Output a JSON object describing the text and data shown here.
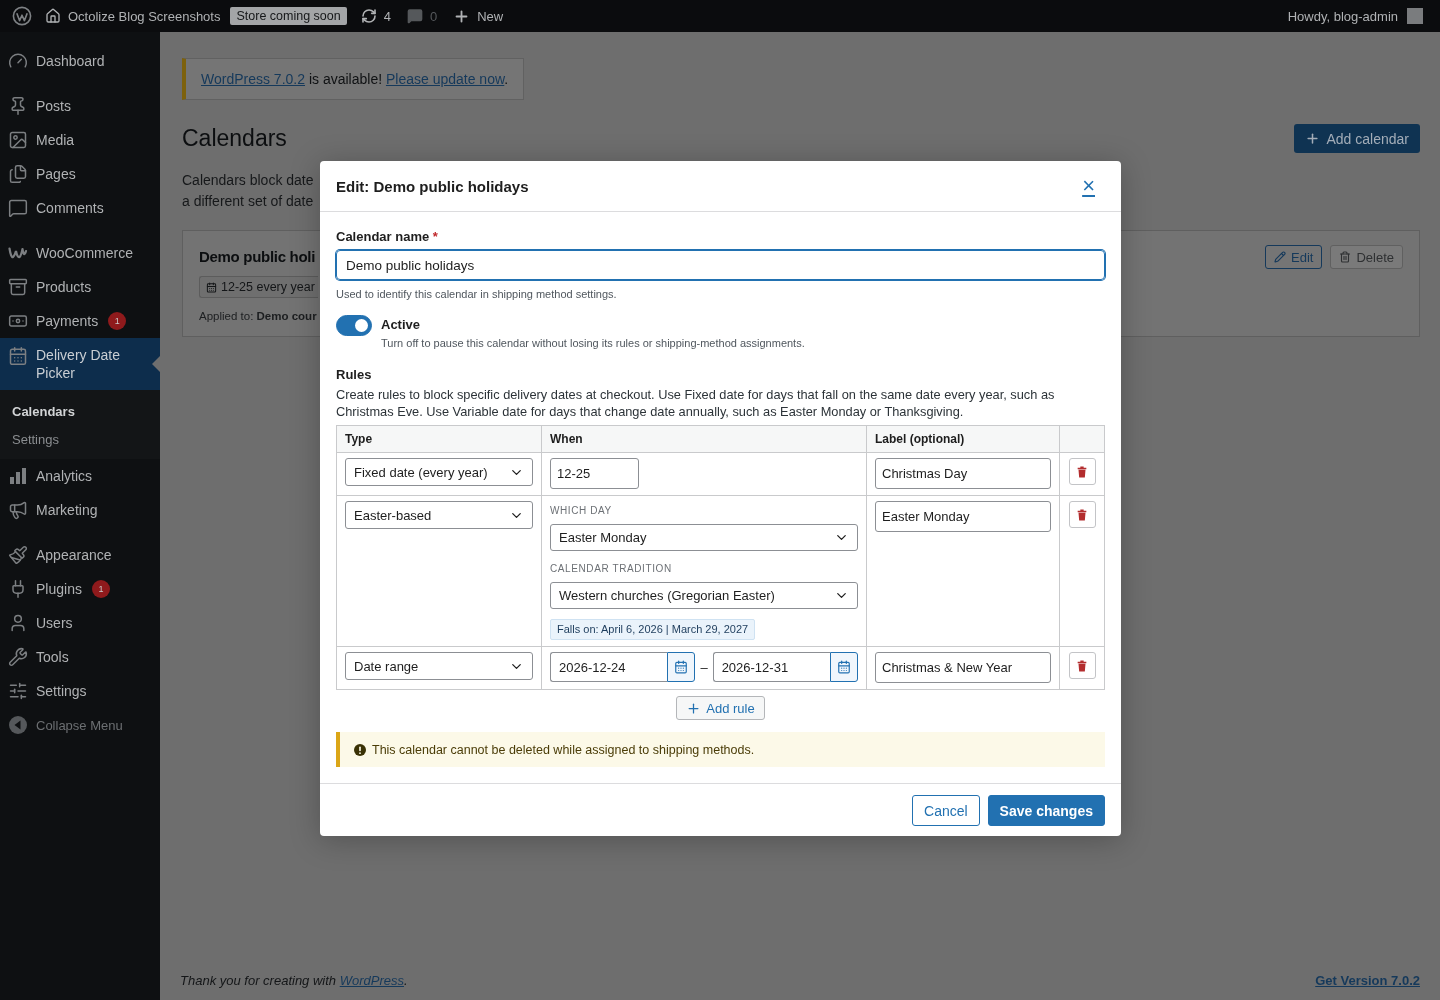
{
  "admin_bar": {
    "site_name": "Octolize Blog Screenshots",
    "store_badge": "Store coming soon",
    "updates_count": "4",
    "comments_count": "0",
    "new_label": "New",
    "greeting": "Howdy, blog-admin"
  },
  "sidebar": {
    "groups": [
      {
        "items": [
          {
            "label": "Dashboard",
            "selected": false
          }
        ]
      },
      {
        "items": [
          {
            "label": "Posts",
            "selected": false
          },
          {
            "label": "Media",
            "selected": false
          },
          {
            "label": "Pages",
            "selected": false
          },
          {
            "label": "Comments",
            "selected": false
          }
        ]
      },
      {
        "items": [
          {
            "label": "WooCommerce",
            "selected": false
          },
          {
            "label": "Products",
            "selected": false
          },
          {
            "label": "Payments",
            "selected": false,
            "badge": "1"
          },
          {
            "label": "Delivery Date Picker",
            "selected": true,
            "submenu": [
              {
                "label": "Calendars",
                "selected": true
              },
              {
                "label": "Settings",
                "selected": false
              }
            ]
          },
          {
            "label": "Analytics",
            "selected": false
          },
          {
            "label": "Marketing",
            "selected": false
          }
        ]
      },
      {
        "items": [
          {
            "label": "Appearance",
            "selected": false
          },
          {
            "label": "Plugins",
            "selected": false,
            "badge": "1"
          },
          {
            "label": "Users",
            "selected": false
          },
          {
            "label": "Tools",
            "selected": false
          },
          {
            "label": "Settings",
            "selected": false
          }
        ]
      }
    ],
    "collapse_label": "Collapse Menu"
  },
  "notice": {
    "parts": [
      {
        "kind": "link",
        "text": "WordPress 7.0.2"
      },
      {
        "kind": "text",
        "text": " is available! "
      },
      {
        "kind": "link",
        "text": "Please update now"
      },
      {
        "kind": "text",
        "text": "."
      }
    ]
  },
  "page": {
    "title": "Calendars",
    "add_button": "Add calendar",
    "description_lines": [
      "Calendars block date",
      "a different set of date"
    ]
  },
  "calendar_card": {
    "title": "Demo public holi",
    "rule_chip": "12-25 every year",
    "applied": "Applied to: **Demo cour**",
    "edit_button": "Edit",
    "delete_button": "Delete",
    "delete_disabled": true
  },
  "modal": {
    "title": "Edit: Demo public holidays",
    "close_label": "×",
    "name_field": {
      "label": "Calendar name",
      "required_mark": "*",
      "value": "Demo public holidays",
      "focused": true,
      "help": "Used to identify this calendar in shipping method settings."
    },
    "active": {
      "label": "Active",
      "on": true,
      "help": "Turn off to pause this calendar without losing its rules or shipping-method assignments."
    },
    "rules": {
      "title": "Rules",
      "description": "Create rules to block specific delivery dates at checkout. Use Fixed date for days that fall on the same date every year, such as Christmas Eve. Use Variable date for days that change date annually, such as Easter Monday or Thanksgiving.",
      "columns": [
        "Type",
        "When",
        "Label (optional)"
      ],
      "rows": [
        {
          "kind": "fixed",
          "type": "Fixed date (every year)",
          "date": "12-25",
          "label": "Christmas Day"
        },
        {
          "kind": "easter",
          "type": "Easter-based",
          "which_day_label": "WHICH DAY",
          "which_day": "Easter Monday",
          "tradition_label": "CALENDAR TRADITION",
          "tradition": "Western churches (Gregorian Easter)",
          "falls_on": "Falls on: April 6, 2026 | March 29, 2027",
          "label": "Easter Monday"
        },
        {
          "kind": "range",
          "type": "Date range",
          "start": "2026-12-24",
          "separator": "–",
          "end": "2026-12-31",
          "label": "Christmas & New Year"
        }
      ],
      "add_button": "Add rule"
    },
    "warning": "This calendar cannot be deleted while assigned to shipping methods.",
    "cancel_button": "Cancel",
    "save_button": "Save changes"
  },
  "footer": {
    "thanks_parts": [
      {
        "kind": "text",
        "text": "Thank you for creating with "
      },
      {
        "kind": "link",
        "text": "WordPress"
      },
      {
        "kind": "text",
        "text": "."
      }
    ],
    "version_link": "Get Version 7.0.2"
  }
}
